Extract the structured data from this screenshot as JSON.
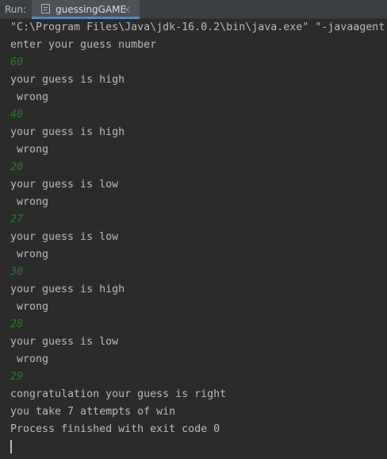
{
  "run_bar": {
    "label": "Run:",
    "tab_title": "guessingGAME",
    "tab_close": "×",
    "tab_icon": "console-icon"
  },
  "console": {
    "lines": [
      {
        "text": "\"C:\\Program Files\\Java\\jdk-16.0.2\\bin\\java.exe\" \"-javaagent",
        "kind": "output"
      },
      {
        "text": "enter your guess number",
        "kind": "output"
      },
      {
        "text": "60",
        "kind": "input"
      },
      {
        "text": "your guess is high",
        "kind": "output"
      },
      {
        "text": " wrong",
        "kind": "output"
      },
      {
        "text": "40",
        "kind": "input"
      },
      {
        "text": "your guess is high",
        "kind": "output"
      },
      {
        "text": " wrong",
        "kind": "output"
      },
      {
        "text": "20",
        "kind": "input"
      },
      {
        "text": "your guess is low",
        "kind": "output"
      },
      {
        "text": " wrong",
        "kind": "output"
      },
      {
        "text": "27",
        "kind": "input"
      },
      {
        "text": "your guess is low",
        "kind": "output"
      },
      {
        "text": " wrong",
        "kind": "output"
      },
      {
        "text": "30",
        "kind": "input"
      },
      {
        "text": "your guess is high",
        "kind": "output"
      },
      {
        "text": " wrong",
        "kind": "output"
      },
      {
        "text": "28",
        "kind": "input"
      },
      {
        "text": "your guess is low",
        "kind": "output"
      },
      {
        "text": " wrong",
        "kind": "output"
      },
      {
        "text": "29",
        "kind": "input"
      },
      {
        "text": "congratulation your guess is right",
        "kind": "output"
      },
      {
        "text": "you take 7 attempts of win",
        "kind": "output"
      },
      {
        "text": "Process finished with exit code 0",
        "kind": "output"
      }
    ]
  },
  "colors": {
    "background": "#2b2b2b",
    "output_text": "#bbbbbb",
    "input_text": "#287b29",
    "tab_accent": "#4a88c7"
  }
}
